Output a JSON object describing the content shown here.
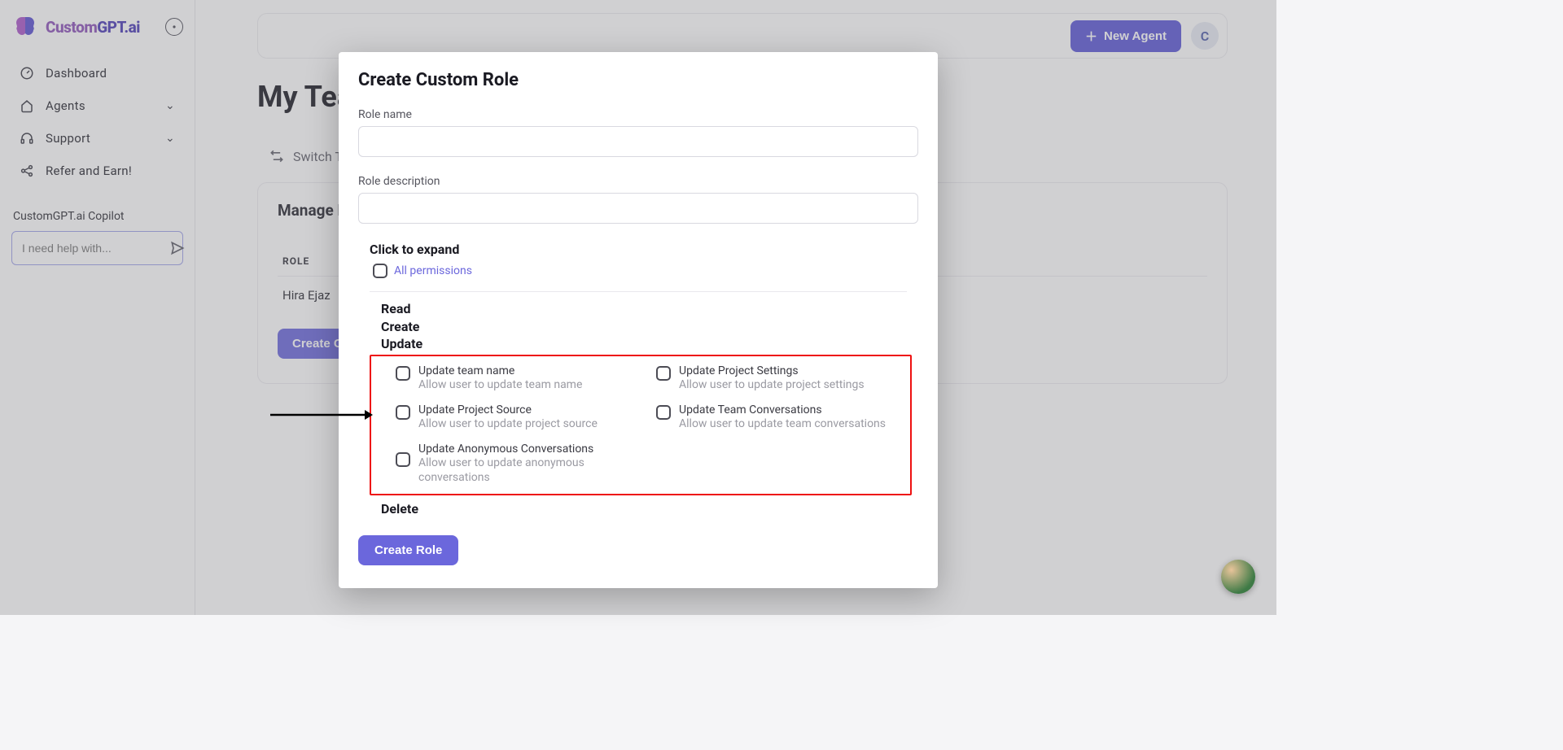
{
  "brand": {
    "name_part1": "Custom",
    "name_part2": "GPT.ai"
  },
  "nav": {
    "dashboard": "Dashboard",
    "agents": "Agents",
    "support": "Support",
    "refer": "Refer and Earn!"
  },
  "copilot": {
    "label": "CustomGPT.ai Copilot",
    "placeholder": "I need help with..."
  },
  "topbar": {
    "new_agent": "New Agent",
    "avatar_initial": "C"
  },
  "page": {
    "title": "My Team",
    "switch_team": "Switch Team"
  },
  "card": {
    "title": "Manage Roles",
    "col_role": "ROLE",
    "row1": "Hira Ejaz",
    "create_custom": "Create Custom Role"
  },
  "modal": {
    "title": "Create Custom Role",
    "role_name_label": "Role name",
    "role_desc_label": "Role description",
    "expand": "Click to expand",
    "all_permissions": "All permissions",
    "sec_read": "Read",
    "sec_create": "Create",
    "sec_update": "Update",
    "sec_delete": "Delete",
    "perms": {
      "team_name": {
        "t": "Update team name",
        "d": "Allow user to update team name"
      },
      "project_settings": {
        "t": "Update Project Settings",
        "d": "Allow user to update project settings"
      },
      "project_source": {
        "t": "Update Project Source",
        "d": "Allow user to update project source"
      },
      "team_conv": {
        "t": "Update Team Conversations",
        "d": "Allow user to update team conversations"
      },
      "anon_conv": {
        "t": "Update Anonymous Conversations",
        "d": "Allow user to update anonymous conversations"
      }
    },
    "create_role_btn": "Create Role"
  }
}
